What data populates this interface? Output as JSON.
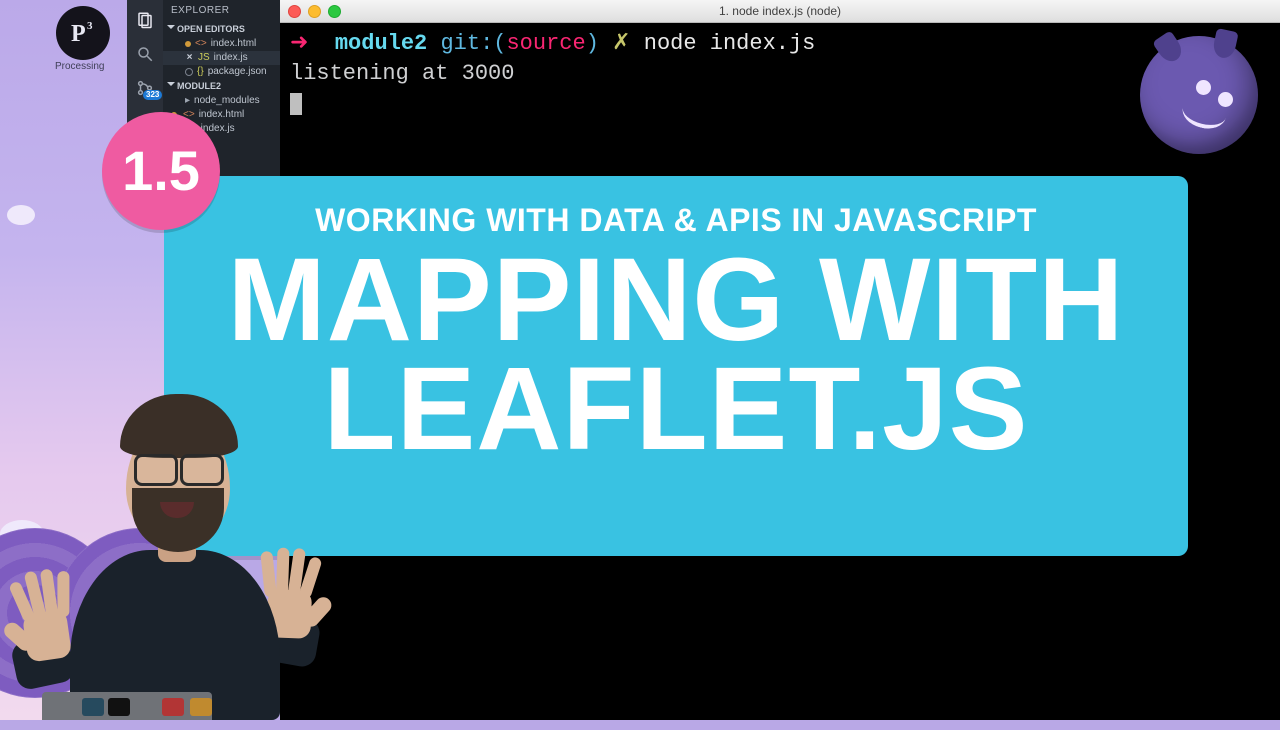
{
  "processing_label": "Processing",
  "vscode": {
    "title": "EXPLORER",
    "badge": "323",
    "sections": {
      "open_editors": "OPEN EDITORS",
      "project": "MODULE2"
    },
    "open_editors": [
      {
        "name": "index.html",
        "kind": "html",
        "marker": "dot"
      },
      {
        "name": "index.js",
        "kind": "js",
        "marker": "close",
        "active": true
      },
      {
        "name": "package.json",
        "kind": "json",
        "marker": "none"
      }
    ],
    "project_files": [
      {
        "name": "node_modules",
        "kind": "dir"
      },
      {
        "name": "index.html",
        "kind": "html",
        "marker": "dot"
      },
      {
        "name": "index.js",
        "kind": "js"
      }
    ]
  },
  "terminal": {
    "title": "1. node index.js (node)",
    "prompt": {
      "arrow": "➜",
      "dir": "module2",
      "git_label": "git:",
      "branch": "source",
      "dirty": "✗",
      "command": "node index.js"
    },
    "output_line": "listening at 3000"
  },
  "title_card": {
    "number": "1.5",
    "subtitle": "WORKING WITH DATA & APIS IN JAVASCRIPT",
    "title_line1": "MAPPING WITH",
    "title_line2": "LEAFLET.JS"
  }
}
